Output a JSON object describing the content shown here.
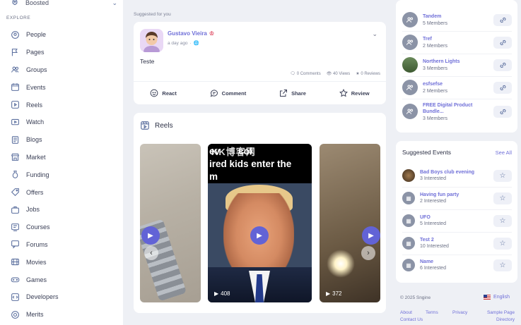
{
  "sidebar": {
    "boosted_label": "Boosted",
    "section_label": "EXPLORE",
    "items": [
      {
        "label": "People",
        "icon": "people-icon"
      },
      {
        "label": "Pages",
        "icon": "flag-icon"
      },
      {
        "label": "Groups",
        "icon": "groups-icon"
      },
      {
        "label": "Events",
        "icon": "calendar-icon"
      },
      {
        "label": "Reels",
        "icon": "reels-icon"
      },
      {
        "label": "Watch",
        "icon": "watch-icon"
      },
      {
        "label": "Blogs",
        "icon": "blogs-icon"
      },
      {
        "label": "Market",
        "icon": "market-icon"
      },
      {
        "label": "Funding",
        "icon": "funding-icon"
      },
      {
        "label": "Offers",
        "icon": "offers-icon"
      },
      {
        "label": "Jobs",
        "icon": "jobs-icon"
      },
      {
        "label": "Courses",
        "icon": "courses-icon"
      },
      {
        "label": "Forums",
        "icon": "forums-icon"
      },
      {
        "label": "Movies",
        "icon": "movies-icon"
      },
      {
        "label": "Games",
        "icon": "games-icon"
      },
      {
        "label": "Developers",
        "icon": "developers-icon"
      },
      {
        "label": "Merits",
        "icon": "merits-icon"
      }
    ]
  },
  "feed": {
    "suggested_label": "Suggested for you",
    "post": {
      "author": "Gustavo Vieira",
      "time": "a day ago",
      "text": "Teste",
      "comments": "0 Comments",
      "views": "40 Views",
      "reviews": "0 Reviews",
      "actions": {
        "react": "React",
        "comment": "Comment",
        "share": "Share",
        "review": "Review"
      }
    },
    "reels": {
      "title": "Reels",
      "caption": "ev       col\nired kids enter the\nm",
      "watermark": "KK博客网",
      "items": [
        {
          "views": ""
        },
        {
          "views": "408"
        },
        {
          "views": "372"
        }
      ]
    }
  },
  "groups": {
    "items": [
      {
        "name": "Tandem",
        "members": "5 Members"
      },
      {
        "name": "Tref",
        "members": "2 Members"
      },
      {
        "name": "Northern Lights",
        "members": "3 Members"
      },
      {
        "name": "esfsefse",
        "members": "2 Members"
      },
      {
        "name": "FREE Digital Product Bundle...",
        "members": "3 Members"
      }
    ]
  },
  "events": {
    "title": "Suggested Events",
    "see_all": "See All",
    "items": [
      {
        "name": "Bad Boys club evening",
        "interested": "3 Interested"
      },
      {
        "name": "Having fun party",
        "interested": "2 Interested"
      },
      {
        "name": "UFO",
        "interested": "5 Interested"
      },
      {
        "name": "Test 2",
        "interested": "10 Interested"
      },
      {
        "name": "Name",
        "interested": "6 Interested"
      }
    ]
  },
  "footer": {
    "copyright": "© 2025 Sngine",
    "language": "English",
    "links": [
      "About",
      "Terms",
      "Privacy",
      "Sample Page",
      "Contact Us",
      "Directory"
    ]
  },
  "colors": {
    "accent": "#6263d6",
    "link": "#6f6fd8",
    "background": "#eef0f5"
  }
}
